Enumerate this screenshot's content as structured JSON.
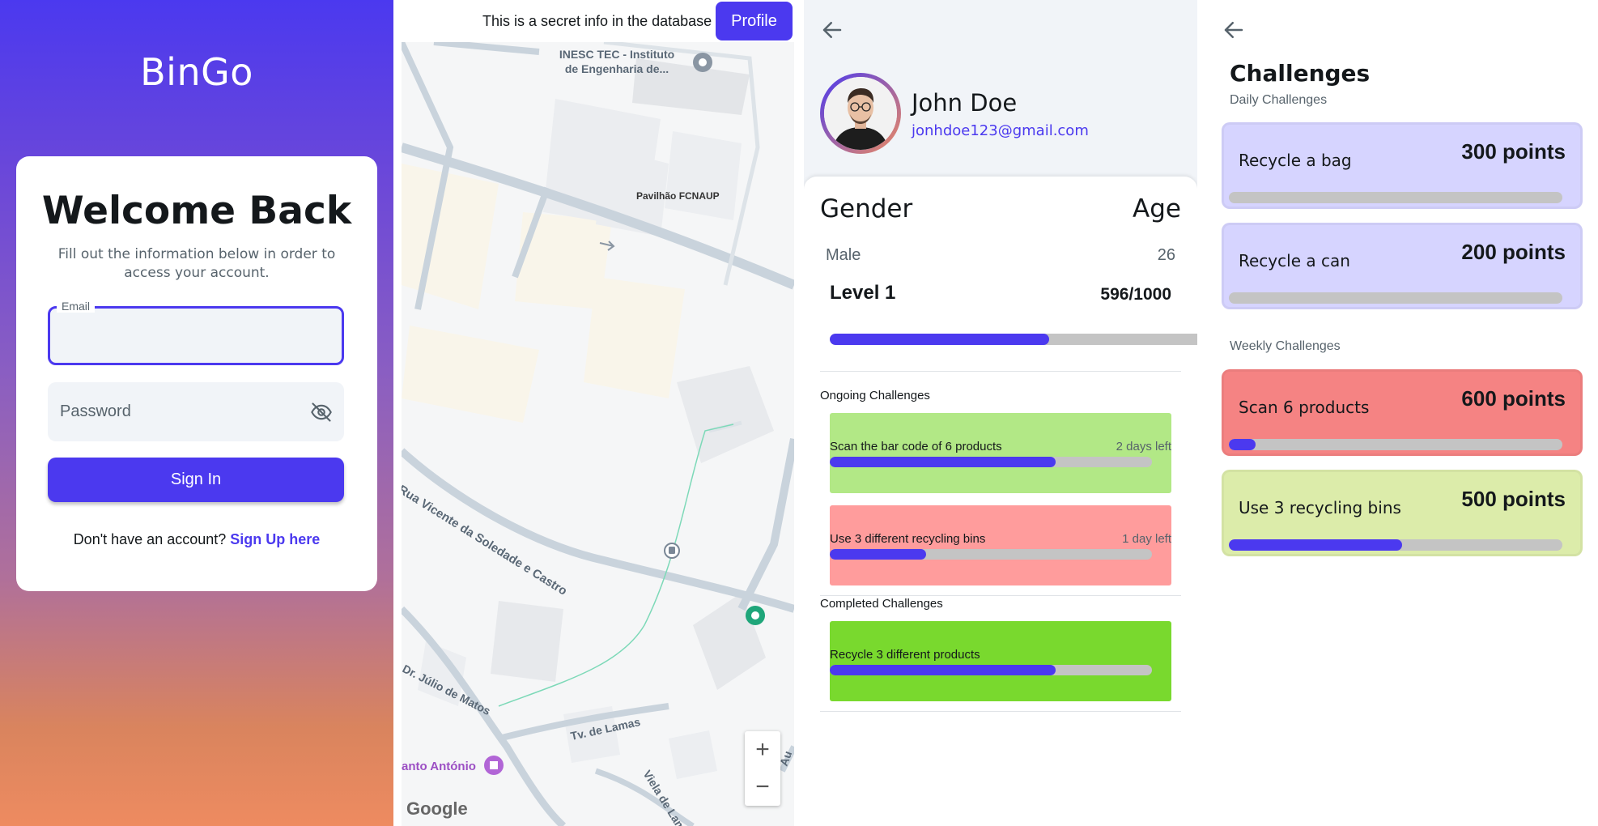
{
  "login": {
    "logo": "BinGo",
    "title": "Welcome Back",
    "subtitle": "Fill out the information below in order to access your account.",
    "email_label": "Email",
    "email_value": "",
    "password_placeholder": "Password",
    "signin_label": "Sign In",
    "no_account_text": "Don't have an account?",
    "signup_link": "Sign Up here",
    "colors": {
      "accent": "#4b39ef",
      "gradient_top": "#4b39ef",
      "gradient_bottom": "#ee8b60"
    }
  },
  "map": {
    "secret_text": "This is a secret info in the database",
    "profile_button": "Profile",
    "labels": {
      "inesc": "INESC TEC - Instituto de Engenharia de...",
      "pavilhao": "Pavilhão FCNAUP",
      "soledade": "Rua Vicente da Soledade e Castro",
      "julio": "Dr. Júlio de Matos",
      "lamas": "Tv. de Lamas",
      "viela": "Viela de Lamas",
      "santo_antonio": "anto António",
      "au": "Au"
    },
    "zoom_in": "+",
    "zoom_out": "−",
    "attribution": "Google"
  },
  "profile": {
    "name": "John Doe",
    "email": "jonhdoe123@gmail.com",
    "gender_header": "Gender",
    "age_header": "Age",
    "gender": "Male",
    "age": "26",
    "level": "Level 1",
    "xp": "596/1000",
    "level_progress": 0.596,
    "ongoing_title": "Ongoing Challenges",
    "completed_title": "Completed Challenges",
    "ongoing": [
      {
        "name": "Scan the bar code of 6 products",
        "time_left": "2 days left",
        "progress": 0.7,
        "color": "#b2e886"
      },
      {
        "name": "Use 3 different recycling bins",
        "time_left": "1 day left",
        "progress": 0.3,
        "color": "#ff9c9c"
      }
    ],
    "completed": [
      {
        "name": "Recycle 3 different products",
        "progress": 0.7,
        "color": "#79d92e"
      }
    ]
  },
  "challenges": {
    "title": "Challenges",
    "daily_title": "Daily Challenges",
    "weekly_title": "Weekly Challenges",
    "daily": [
      {
        "name": "Recycle a bag",
        "points": "300 points",
        "progress": 0,
        "color": "#d6d4ff"
      },
      {
        "name": "Recycle a can",
        "points": "200 points",
        "progress": 0,
        "color": "#d6d4ff"
      }
    ],
    "weekly": [
      {
        "name": "Scan 6 products",
        "points": "600 points",
        "progress": 0.08,
        "color": "#f58383"
      },
      {
        "name": "Use 3 recycling bins",
        "points": "500 points",
        "progress": 0.52,
        "color": "#dcecaa"
      }
    ]
  }
}
